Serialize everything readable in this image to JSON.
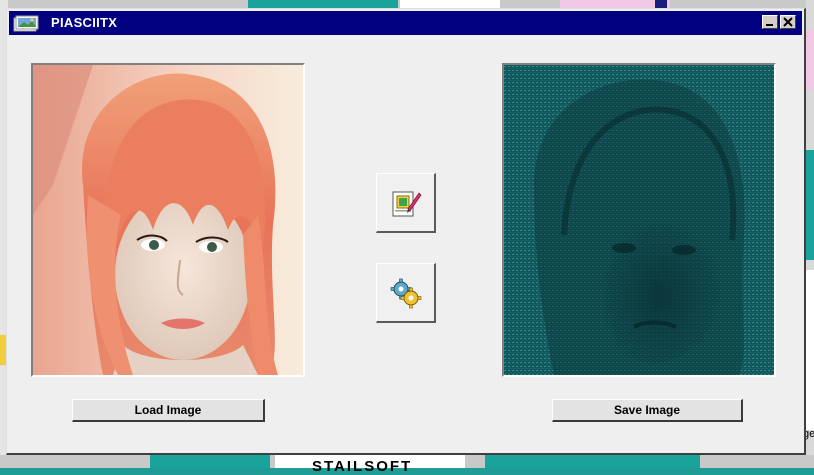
{
  "window": {
    "title": "PIASCIITX",
    "minimize_icon": "minimize-icon",
    "close_icon": "close-icon",
    "app_icon": "app-photos-icon"
  },
  "panels": {
    "source_image": "portrait photo, orange-red hair with bangs",
    "output_image": "ascii-art rendering in teal on dark teal"
  },
  "tools": {
    "convert_icon": "edit-image-icon",
    "settings_icon": "gears-icon"
  },
  "buttons": {
    "load_label": "Load Image",
    "save_label": "Save Image"
  },
  "background": {
    "fragment_text_bottom": "STAILSOFT",
    "fragment_text_right": "ge"
  },
  "colors": {
    "titlebar": "#000080",
    "window": "#efefef",
    "desktop": "#1f9c95",
    "ascii_bg": "#0e4a4e",
    "ascii_fg": "#3fb3b6",
    "hair": "#e8735a"
  }
}
